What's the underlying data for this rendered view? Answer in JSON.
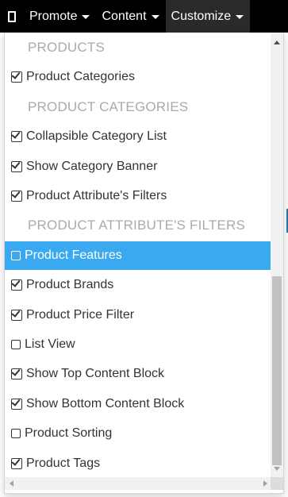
{
  "navbar": {
    "mobile_icon": "mobile-phone-icon",
    "items": [
      {
        "label": "Promote",
        "active": false
      },
      {
        "label": "Content",
        "active": false
      },
      {
        "label": "Customize",
        "active": true
      }
    ]
  },
  "dropdown": {
    "entries": [
      {
        "kind": "header",
        "label": "PRODUCTS"
      },
      {
        "kind": "option",
        "label": "Product Categories",
        "checked": true,
        "highlighted": false
      },
      {
        "kind": "header",
        "label": "PRODUCT CATEGORIES"
      },
      {
        "kind": "option",
        "label": "Collapsible Category List",
        "checked": true,
        "highlighted": false
      },
      {
        "kind": "option",
        "label": "Show Category Banner",
        "checked": true,
        "highlighted": false
      },
      {
        "kind": "option",
        "label": "Product Attribute's Filters",
        "checked": true,
        "highlighted": false
      },
      {
        "kind": "header",
        "label": "PRODUCT ATTRIBUTE'S FILTERS"
      },
      {
        "kind": "option",
        "label": "Product Features",
        "checked": false,
        "highlighted": true
      },
      {
        "kind": "option",
        "label": "Product Brands",
        "checked": true,
        "highlighted": false
      },
      {
        "kind": "option",
        "label": "Product Price Filter",
        "checked": true,
        "highlighted": false
      },
      {
        "kind": "option",
        "label": "List View",
        "checked": false,
        "highlighted": false
      },
      {
        "kind": "option",
        "label": "Show Top Content Block",
        "checked": true,
        "highlighted": false
      },
      {
        "kind": "option",
        "label": "Show Bottom Content Block",
        "checked": true,
        "highlighted": false
      },
      {
        "kind": "option",
        "label": "Product Sorting",
        "checked": false,
        "highlighted": false
      },
      {
        "kind": "option",
        "label": "Product Tags",
        "checked": true,
        "highlighted": false
      }
    ]
  },
  "colors": {
    "navbar_bg": "#000000",
    "highlight_bg": "#3aa9f0",
    "header_text": "#aaaaaa",
    "item_text": "#333333"
  }
}
